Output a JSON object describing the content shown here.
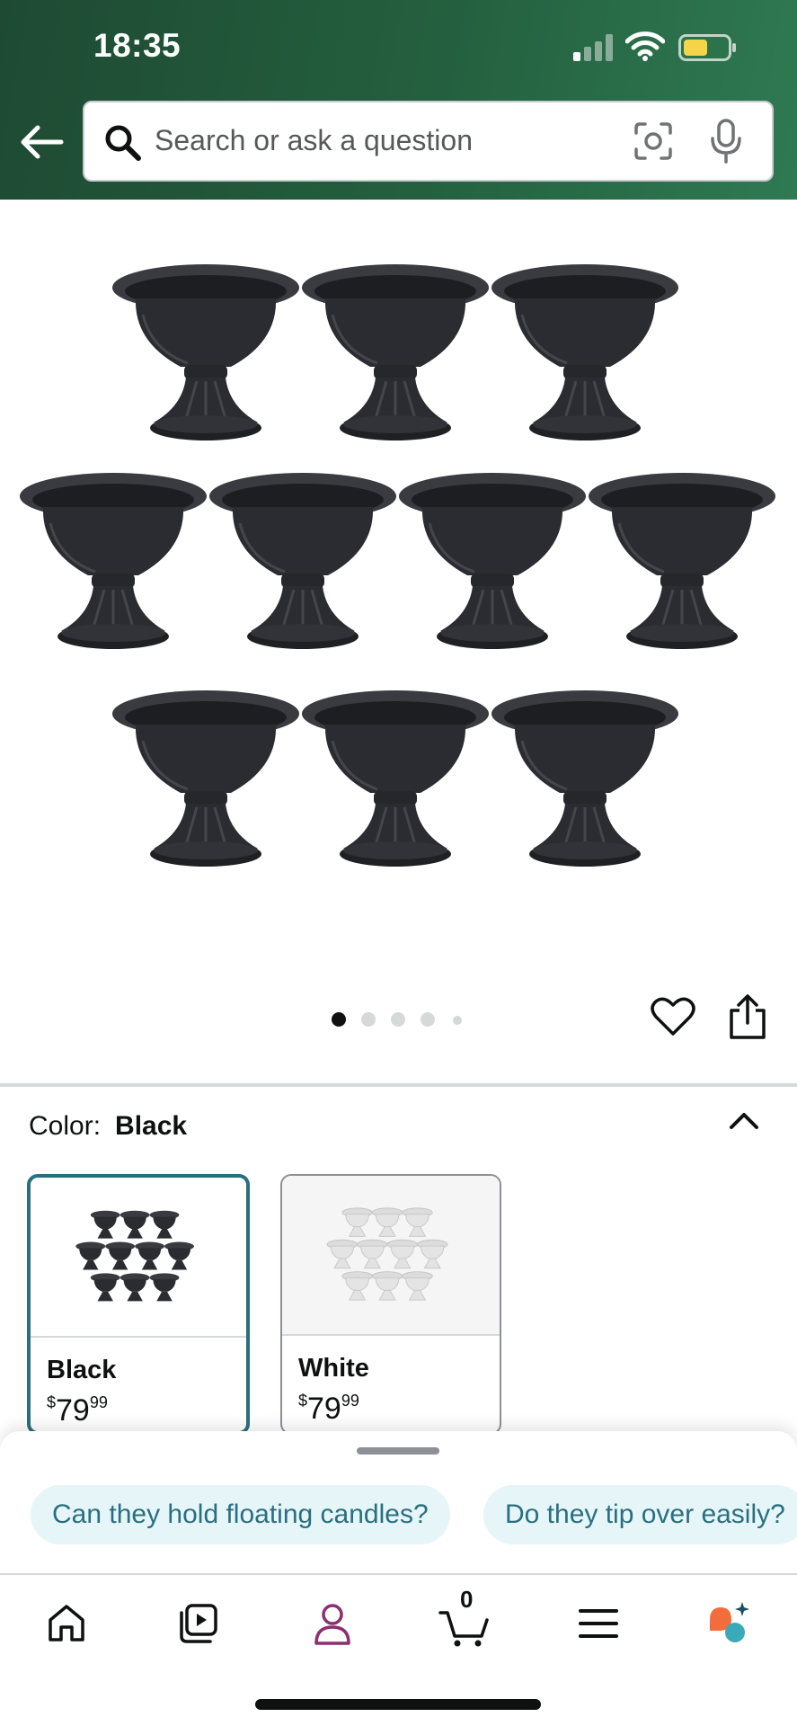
{
  "status_bar": {
    "time": "18:35"
  },
  "search": {
    "placeholder": "Search or ask a question"
  },
  "product": {
    "image_alt": "Black pedestal urn vases, set of 10",
    "image_count": 5,
    "current_image": 1
  },
  "color_selector": {
    "label": "Color:",
    "selected": "Black",
    "options": [
      {
        "name": "Black",
        "price_symbol": "$",
        "price_whole": "79",
        "price_fraction": "99",
        "selected": true
      },
      {
        "name": "White",
        "price_symbol": "$",
        "price_whole": "79",
        "price_fraction": "99",
        "selected": false
      }
    ]
  },
  "suggestions": [
    "Can they hold floating candles?",
    "Do they tip over easily?"
  ],
  "tabbar": {
    "items": [
      "home-icon",
      "video-icon",
      "account-icon",
      "cart-icon",
      "menu-icon",
      "assistant-icon"
    ],
    "cart_count": "0"
  },
  "colors": {
    "header_dark": "#1e4a33",
    "accent_teal": "#2a6f80",
    "chip_bg": "#e6f6f8",
    "account_purple": "#8b2e72"
  }
}
